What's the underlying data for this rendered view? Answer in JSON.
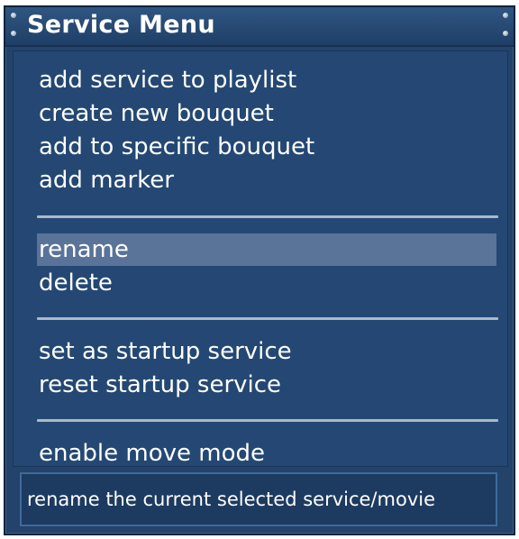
{
  "window": {
    "title": "Service Menu"
  },
  "menu": {
    "items": [
      {
        "label": "add service to playlist",
        "selected": false
      },
      {
        "label": "create new bouquet",
        "selected": false
      },
      {
        "label": "add to specific bouquet",
        "selected": false
      },
      {
        "label": "add marker",
        "selected": false
      },
      {
        "label": "rename",
        "selected": true
      },
      {
        "label": "delete",
        "selected": false
      },
      {
        "label": "set as startup service",
        "selected": false
      },
      {
        "label": "reset startup service",
        "selected": false
      },
      {
        "label": "enable move mode",
        "selected": false
      }
    ]
  },
  "status": {
    "text": "rename the current selected service/movie"
  },
  "colors": {
    "background": "#23436a",
    "selection": "#5a7399",
    "separator": "#aeb8c6",
    "text": "#ffffff"
  }
}
